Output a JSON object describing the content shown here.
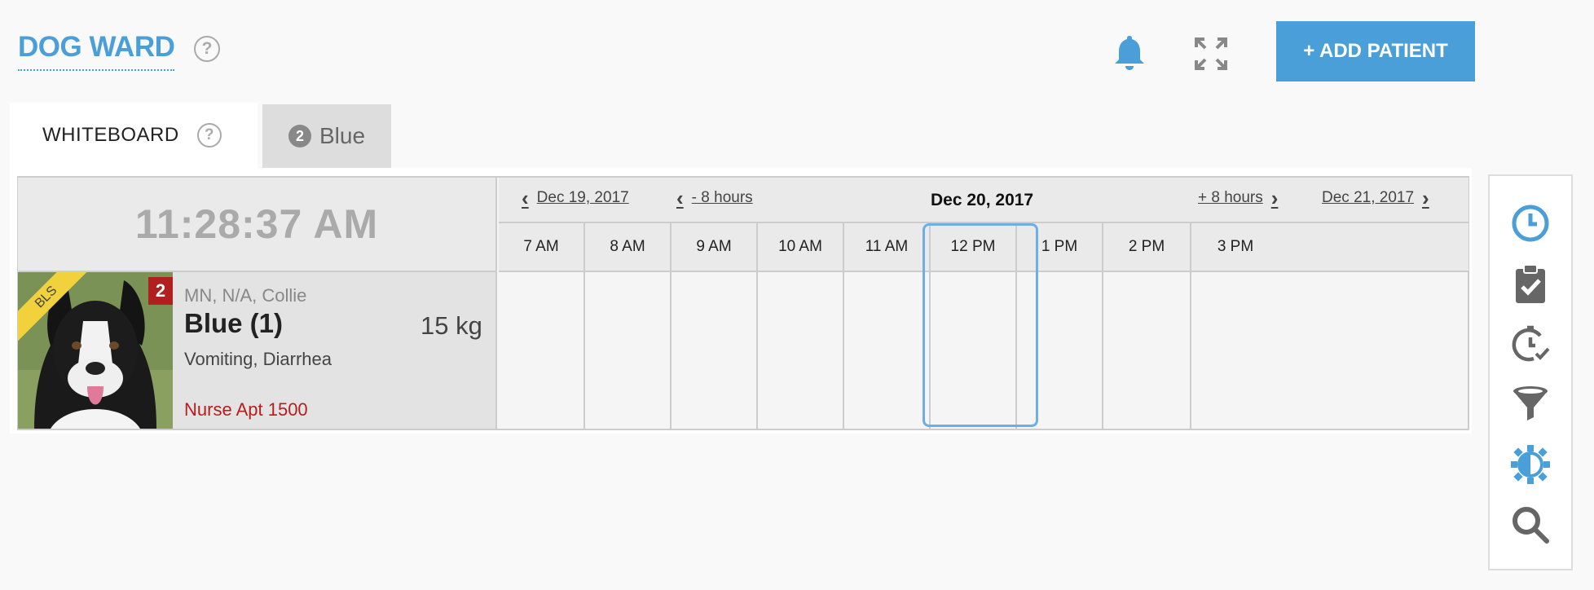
{
  "header": {
    "ward_title": "DOG WARD",
    "help_glyph": "?",
    "add_patient_label": "+ ADD PATIENT"
  },
  "tabs": [
    {
      "label": "WHITEBOARD",
      "help_glyph": "?"
    },
    {
      "label": "Blue",
      "count": "2"
    }
  ],
  "board": {
    "clock": "11:28:37 AM",
    "nav": {
      "prev_day": "Dec 19, 2017",
      "prev_hours": "- 8 hours",
      "current_date": "Dec 20, 2017",
      "next_hours": "+ 8 hours",
      "next_day": "Dec 21, 2017"
    },
    "hours": [
      "7 AM",
      "8 AM",
      "9 AM",
      "10 AM",
      "11 AM",
      "12 PM",
      "1 PM",
      "2 PM",
      "3 PM"
    ],
    "current_hour": "11 AM"
  },
  "patient": {
    "ribbon": "BLS",
    "badge": "2",
    "descriptor": "MN, N/A, Collie",
    "name": "Blue (1)",
    "weight": "15 kg",
    "complaint": "Vomiting, Diarrhea",
    "appointment": "Nurse Apt 1500"
  },
  "toolbar": {
    "icons": [
      "clock-icon",
      "clipboard-check-icon",
      "history-check-icon",
      "filter-icon",
      "contrast-icon",
      "search-icon"
    ],
    "accent": "#4a9fd8",
    "muted": "#666666"
  },
  "colors": {
    "accent": "#4a9fd8",
    "alert": "#b02020",
    "ribbon": "#f2d23c"
  }
}
